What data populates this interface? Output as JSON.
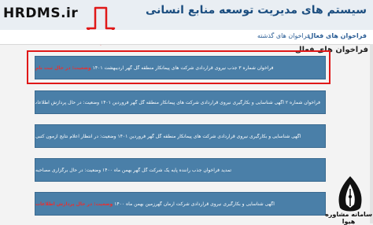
{
  "watermark": "HRDMS.ir",
  "header": {
    "title": "سیستم های مدیریت توسعه منابع انسانی"
  },
  "nav": {
    "tabs": [
      {
        "label": "فراخوان های فعال"
      },
      {
        "label": "فراخوان های گذشته"
      }
    ]
  },
  "section": {
    "title": "فراخوان های فعال"
  },
  "items": [
    {
      "text": "فراخوان شماره ۳ جذب نیروی قراردادی شرکت های پیمانکار منطقه گل گهر اردیبهشت ۱۴۰۱",
      "status": "وضعیت: در حال ثبت نام"
    },
    {
      "text": "فراخوان شماره ۲ آگهی شناسایی و بکارگیری نیروی قراردادی شرکت های پیمانکار منطقه گل گهر فروردین ۱۴۰۱ وضعیت: در حال پردازش اطلاعات",
      "status": ""
    },
    {
      "text": "آگهی شناسایی و بکارگیری نیروی قراردادی شرکت های پیمانکار منطقه گل گهر فروردین ۱۴۰۱ وضعیت: در انتظار اعلام نتایج آزمون کتبی",
      "status": ""
    },
    {
      "text": "تمدید فراخوان جذب راننده پایه یک شرکت گل گهر بهمن ماه ۱۴۰۰ وضعیت: در حال برگزاری مصاحبه",
      "status": ""
    },
    {
      "text": "آگهی شناسایی و بکارگیری نیروی قراردادی شرکت آرمان گهرزمین بهمن ماه ۱۴۰۰",
      "status": "وضعیت: در حال پردازش اطلاعات"
    }
  ],
  "logo": {
    "text": "سامانه مشاوره هیوا",
    "icon": "pen-nib-icon"
  },
  "colors": {
    "item_bg": "#4a7fa8",
    "highlight": "#e01818",
    "status_red": "#e83030"
  }
}
